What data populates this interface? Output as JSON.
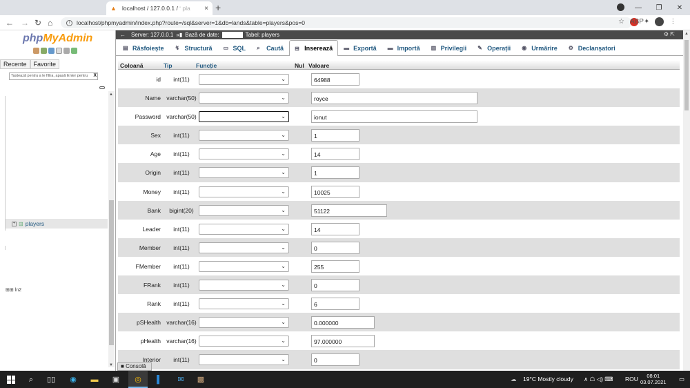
{
  "browser": {
    "tab_title": "localhost / 127.0.0.1 / ",
    "tab_title_faded": "ʻ pla",
    "tab_close": "×",
    "new_tab": "+",
    "url": "localhost/phpmyadmin/index.php?route=/sql&server=1&db=lands&table=players&pos=0",
    "ext_label": "ABP"
  },
  "sidebar": {
    "logo_php": "php",
    "logo_myadmin": "MyAdmin",
    "tabs": [
      "Recente",
      "Favorite"
    ],
    "filter_placeholder": "Tastează pentru a le filtra, apasă Enter pentru",
    "filter_clear": "X",
    "tree_item": "players",
    "tree_item2": "ln2"
  },
  "breadcrumb": {
    "server": "Server: 127.0.0.1",
    "db_label": "Bază de date:",
    "table": "Tabel: players"
  },
  "tabs": [
    {
      "label": "Răsfoiește",
      "icon": "browse-icon"
    },
    {
      "label": "Structură",
      "icon": "structure-icon"
    },
    {
      "label": "SQL",
      "icon": "sql-icon"
    },
    {
      "label": "Caută",
      "icon": "search-icon"
    },
    {
      "label": "Inserează",
      "icon": "insert-icon",
      "active": true
    },
    {
      "label": "Exportă",
      "icon": "export-icon"
    },
    {
      "label": "Importă",
      "icon": "import-icon"
    },
    {
      "label": "Privilegii",
      "icon": "privileges-icon"
    },
    {
      "label": "Operații",
      "icon": "operations-icon"
    },
    {
      "label": "Urmărire",
      "icon": "tracking-icon"
    },
    {
      "label": "Declanșatori",
      "icon": "triggers-icon"
    }
  ],
  "columns": {
    "col": "Coloană",
    "type": "Tip",
    "func": "Funcție",
    "null": "Nul",
    "value": "Valoare"
  },
  "rows": [
    {
      "name": "id",
      "type": "int(11)",
      "value": "64988",
      "width": 70
    },
    {
      "name": "Name",
      "type": "varchar(50)",
      "value": "royce",
      "width": 241
    },
    {
      "name": "Password",
      "type": "varchar(50)",
      "value": "ionut",
      "width": 241,
      "focused": true
    },
    {
      "name": "Sex",
      "type": "int(11)",
      "value": "1",
      "width": 70
    },
    {
      "name": "Age",
      "type": "int(11)",
      "value": "14",
      "width": 70
    },
    {
      "name": "Origin",
      "type": "int(11)",
      "value": "1",
      "width": 70
    },
    {
      "name": "Money",
      "type": "int(11)",
      "value": "10025",
      "width": 70
    },
    {
      "name": "Bank",
      "type": "bigint(20)",
      "value": "51122",
      "width": 110
    },
    {
      "name": "Leader",
      "type": "int(11)",
      "value": "14",
      "width": 70
    },
    {
      "name": "Member",
      "type": "int(11)",
      "value": "0",
      "width": 70
    },
    {
      "name": "FMember",
      "type": "int(11)",
      "value": "255",
      "width": 70
    },
    {
      "name": "FRank",
      "type": "int(11)",
      "value": "0",
      "width": 70
    },
    {
      "name": "Rank",
      "type": "int(11)",
      "value": "6",
      "width": 70
    },
    {
      "name": "pSHealth",
      "type": "varchar(16)",
      "value": "0.000000",
      "width": 92
    },
    {
      "name": "pHealth",
      "type": "varchar(16)",
      "value": "97.000000",
      "width": 92
    },
    {
      "name": "Interior",
      "type": "int(11)",
      "value": "0",
      "width": 70
    }
  ],
  "console": "Consolă",
  "taskbar": {
    "weather": "19°C  Mostly cloudy",
    "lang": "ROU",
    "time": "08:01",
    "date": "03.07.2021"
  }
}
